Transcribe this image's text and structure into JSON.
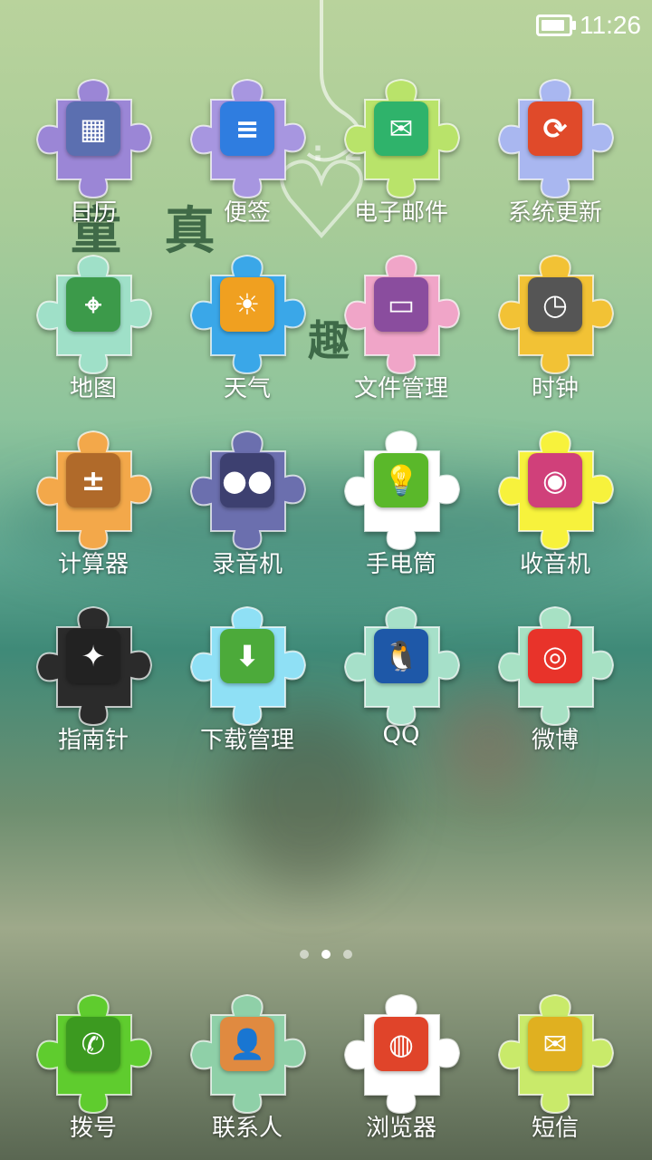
{
  "status_bar": {
    "time": "11:26",
    "battery_level": 0.9
  },
  "wallpaper": {
    "text1": "童 真",
    "text2": "趣",
    "clock_fragment": ": 2"
  },
  "page_indicator": {
    "count": 3,
    "active_index": 1
  },
  "apps": [
    {
      "label": "日历",
      "icon": "calendar-icon",
      "piece_color": "#9b86d6"
    },
    {
      "label": "便签",
      "icon": "note-icon",
      "piece_color": "#a796e0"
    },
    {
      "label": "电子邮件",
      "icon": "email-icon",
      "piece_color": "#b9e36a"
    },
    {
      "label": "系统更新",
      "icon": "system-update-icon",
      "piece_color": "#a9b7f0"
    },
    {
      "label": "地图",
      "icon": "map-icon",
      "piece_color": "#9fe0c8"
    },
    {
      "label": "天气",
      "icon": "weather-icon",
      "piece_color": "#3aa7e8"
    },
    {
      "label": "文件管理",
      "icon": "folder-icon",
      "piece_color": "#f0a5c8"
    },
    {
      "label": "时钟",
      "icon": "clock-icon",
      "piece_color": "#f2c235"
    },
    {
      "label": "计算器",
      "icon": "calculator-icon",
      "piece_color": "#f3a84a"
    },
    {
      "label": "录音机",
      "icon": "recorder-icon",
      "piece_color": "#6b6fae"
    },
    {
      "label": "手电筒",
      "icon": "flashlight-icon",
      "piece_color": "#ffffff"
    },
    {
      "label": "收音机",
      "icon": "radio-icon",
      "piece_color": "#f7f23c"
    },
    {
      "label": "指南针",
      "icon": "compass-icon",
      "piece_color": "#2b2b2b"
    },
    {
      "label": "下载管理",
      "icon": "download-icon",
      "piece_color": "#8fe0f5"
    },
    {
      "label": "QQ",
      "icon": "qq-penguin-icon",
      "piece_color": "#a6e0c9"
    },
    {
      "label": "微博",
      "icon": "weibo-icon",
      "piece_color": "#a7e1c4"
    }
  ],
  "dock": [
    {
      "label": "拨号",
      "icon": "phone-icon",
      "piece_color": "#5fcc2e"
    },
    {
      "label": "联系人",
      "icon": "contacts-icon",
      "piece_color": "#8fd0a8"
    },
    {
      "label": "浏览器",
      "icon": "browser-icon",
      "piece_color": "#ffffff"
    },
    {
      "label": "短信",
      "icon": "message-icon",
      "piece_color": "#c9ea6a"
    }
  ]
}
